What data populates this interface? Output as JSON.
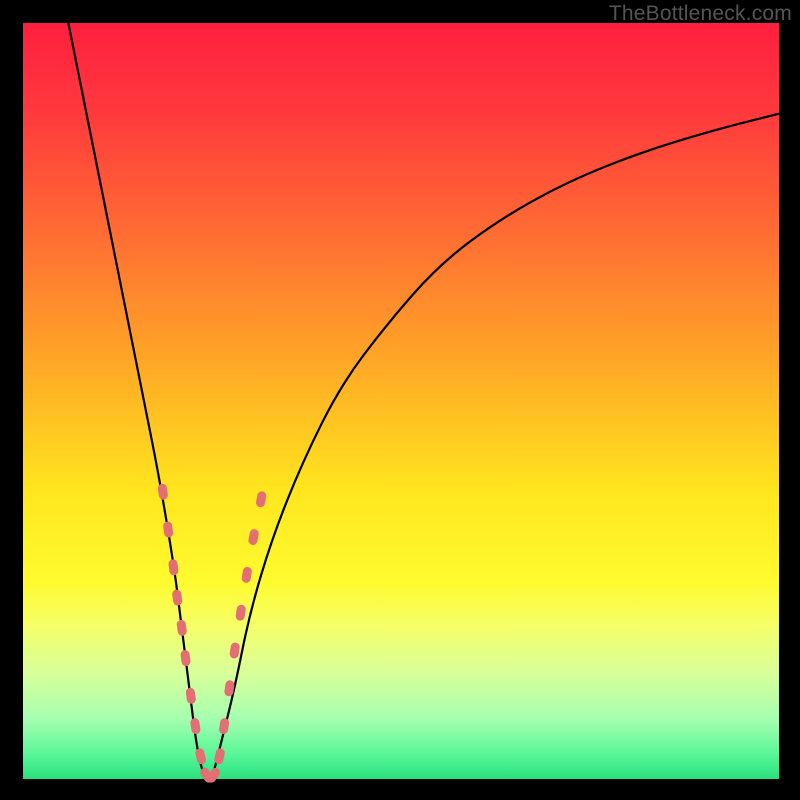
{
  "watermark": "TheBottleneck.com",
  "gradient": {
    "stops": [
      {
        "pct": 0,
        "color": "#ff1f3f"
      },
      {
        "pct": 12,
        "color": "#ff3a3d"
      },
      {
        "pct": 28,
        "color": "#ff6d33"
      },
      {
        "pct": 45,
        "color": "#ffa826"
      },
      {
        "pct": 62,
        "color": "#ffe61e"
      },
      {
        "pct": 74,
        "color": "#fffb30"
      },
      {
        "pct": 80,
        "color": "#f4ff6a"
      },
      {
        "pct": 86,
        "color": "#d8ff9a"
      },
      {
        "pct": 92,
        "color": "#a6ffb0"
      },
      {
        "pct": 97,
        "color": "#55f596"
      },
      {
        "pct": 100,
        "color": "#29e07d"
      }
    ]
  },
  "chart_data": {
    "type": "line",
    "title": "",
    "xlabel": "",
    "ylabel": "",
    "xlim": [
      0,
      100
    ],
    "ylim": [
      0,
      100
    ],
    "note": "V-shaped bottleneck curve; x is relative component strength, y is bottleneck percentage (0 at minimum). Values estimated from pixel positions.",
    "series": [
      {
        "name": "bottleneck-curve",
        "x": [
          6,
          8,
          10,
          12,
          14,
          16,
          18,
          20,
          21,
          22,
          23,
          24,
          25,
          26,
          28,
          30,
          33,
          37,
          42,
          48,
          55,
          63,
          72,
          82,
          92,
          100
        ],
        "y": [
          100,
          90,
          80,
          70,
          60,
          50,
          40,
          28,
          20,
          12,
          4,
          0,
          0,
          4,
          12,
          22,
          32,
          42,
          52,
          60,
          68,
          74,
          79,
          83,
          86,
          88
        ]
      }
    ],
    "markers": {
      "name": "sample-points",
      "color": "#e36f74",
      "points": [
        {
          "x": 18.5,
          "y": 38
        },
        {
          "x": 19.2,
          "y": 33
        },
        {
          "x": 19.9,
          "y": 28
        },
        {
          "x": 20.4,
          "y": 24
        },
        {
          "x": 21.0,
          "y": 20
        },
        {
          "x": 21.5,
          "y": 16
        },
        {
          "x": 22.2,
          "y": 11
        },
        {
          "x": 22.8,
          "y": 7
        },
        {
          "x": 23.5,
          "y": 3
        },
        {
          "x": 24.3,
          "y": 0.5
        },
        {
          "x": 25.2,
          "y": 0.5
        },
        {
          "x": 26.0,
          "y": 3
        },
        {
          "x": 26.6,
          "y": 7
        },
        {
          "x": 27.3,
          "y": 12
        },
        {
          "x": 28.0,
          "y": 17
        },
        {
          "x": 28.8,
          "y": 22
        },
        {
          "x": 29.6,
          "y": 27
        },
        {
          "x": 30.5,
          "y": 32
        },
        {
          "x": 31.5,
          "y": 37
        }
      ]
    }
  }
}
